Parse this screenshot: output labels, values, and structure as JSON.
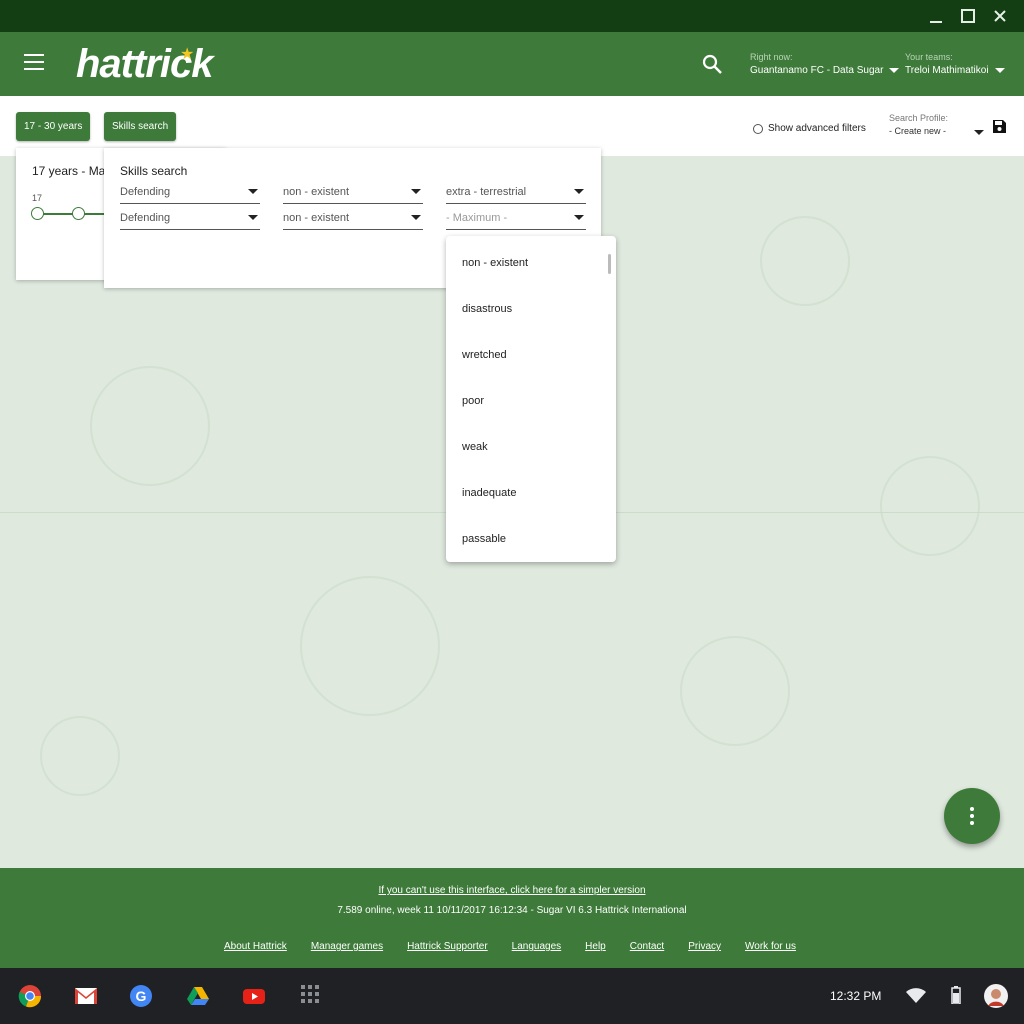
{
  "window": {
    "controls": [
      "minimize-icon",
      "maximize-icon",
      "close-icon"
    ]
  },
  "header": {
    "logo_text": "hattrick",
    "right_now_label": "Right now:",
    "right_now_value": "Guantanamo FC - Data Sugar",
    "your_teams_label": "Your teams:",
    "your_teams_value": "Treloi Mathimatikoi"
  },
  "toolbar": {
    "age_chip": "17 - 30 years",
    "skills_chip": "Skills search",
    "advanced_filters": "Show advanced filters",
    "search_profile_label": "Search Profile:",
    "search_profile_value": "- Create new -"
  },
  "age_panel": {
    "title": "17 years  - Ma",
    "min_label": "17"
  },
  "skills_panel": {
    "title": "Skills search",
    "rows": [
      {
        "skill": "Defending",
        "min": "non - existent",
        "max": "extra - terrestrial"
      },
      {
        "skill": "Defending",
        "min": "non - existent",
        "max": "- Maximum -"
      }
    ]
  },
  "dropdown": {
    "options": [
      "non - existent",
      "disastrous",
      "wretched",
      "poor",
      "weak",
      "inadequate",
      "passable"
    ]
  },
  "footer": {
    "simple_link": "If you can't use this interface, click here for a simpler version",
    "status": "7.589 online, week 11 10/11/2017 16:12:34 - Sugar VI 6.3 Hattrick International",
    "links": [
      "About Hattrick",
      "Manager games",
      "Hattrick Supporter",
      "Languages",
      "Help",
      "Contact",
      "Privacy",
      "Work for us"
    ]
  },
  "shelf": {
    "apps": [
      "chrome-icon",
      "gmail-icon",
      "google-icon",
      "drive-icon",
      "youtube-icon",
      "app-launcher-icon"
    ],
    "clock": "12:32 PM"
  },
  "colors": {
    "title_bar": "#133d13",
    "brand_green": "#3e7b3a",
    "background": "#dfe9de",
    "shelf": "#202124"
  }
}
